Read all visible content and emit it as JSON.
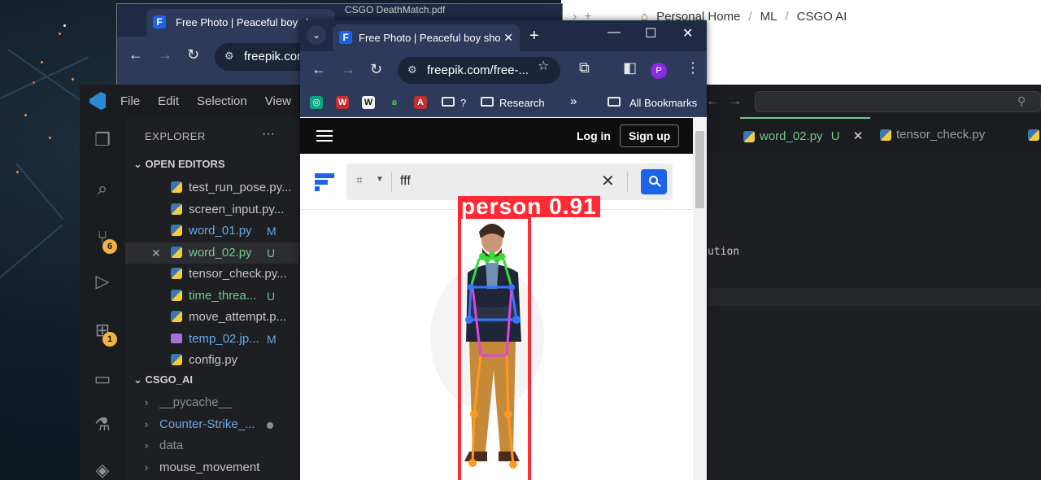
{
  "notion": {
    "breadcrumbs": [
      "Personal Home",
      "ML",
      "CSGO AI"
    ],
    "separator": "/"
  },
  "back_browser": {
    "tab_title": "Free Photo | Peaceful boy sh",
    "other_tab_title": "CSGO DeathMatch.pdf",
    "address": "freepik.com"
  },
  "vscode": {
    "menu": [
      "File",
      "Edit",
      "Selection",
      "View"
    ],
    "explorer_title": "EXPLORER",
    "more": "···",
    "open_editors_label": "OPEN EDITORS",
    "open_editors": [
      {
        "name": "test_run_pose.py...",
        "status": "",
        "color": "#c5c5c5"
      },
      {
        "name": "screen_input.py...",
        "status": "",
        "color": "#c5c5c5"
      },
      {
        "name": "word_01.py",
        "status": "M",
        "color": "#6aa8e6"
      },
      {
        "name": "word_02.py",
        "status": "U",
        "color": "#73c991",
        "active": true
      },
      {
        "name": "tensor_check.py...",
        "status": "",
        "color": "#c5c5c5"
      },
      {
        "name": "time_threa...",
        "status": "U",
        "color": "#73c991"
      },
      {
        "name": "move_attempt.p...",
        "status": "",
        "color": "#c5c5c5"
      },
      {
        "name": "temp_02.jp...",
        "status": "M",
        "color": "#6aa8e6",
        "image": true
      },
      {
        "name": "config.py",
        "status": "",
        "color": "#c5c5c5"
      }
    ],
    "project_label": "CSGO_AI",
    "folders": [
      {
        "name": "__pycache__",
        "color": "#8b8f94"
      },
      {
        "name": "Counter-Strike_...",
        "color": "#6aa8e6",
        "dot": true
      },
      {
        "name": "data",
        "color": "#8b8f94"
      },
      {
        "name": "mouse_movement",
        "color": "#c5c5c5"
      }
    ],
    "badges": {
      "source_control": "6",
      "extensions": "1"
    },
    "editor_tabs": [
      {
        "name": "word_02.py",
        "status": "U",
        "active": true
      },
      {
        "name": "tensor_check.py",
        "status": "",
        "active": false
      }
    ],
    "code_fragment": "ution"
  },
  "front_browser": {
    "tab_title": "Free Photo | Peaceful boy sho",
    "address": "freepik.com/free-...",
    "profile_initial": "P",
    "bookmarks": [
      "?",
      "Research"
    ],
    "all_bookmarks": "All Bookmarks",
    "page": {
      "login": "Log in",
      "signup": "Sign up",
      "search_query": "fff"
    }
  },
  "detection": {
    "label": "person 0.91",
    "box_color": "#ff2a35"
  }
}
